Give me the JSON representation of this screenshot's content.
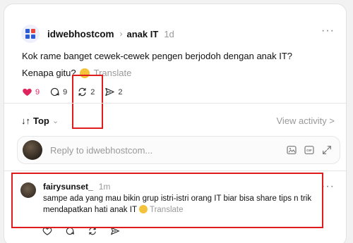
{
  "post": {
    "author": "idwebhostcom",
    "community": "anak IT",
    "time": "1d",
    "more": "···",
    "text_line1": "Kok rame banget cewek-cewek pengen berjodoh dengan anak IT?",
    "text_line2": "Kenapa gitu?",
    "translate": "Translate",
    "likes": "9",
    "comments": "9",
    "reposts": "2",
    "shares": "2"
  },
  "thread": {
    "sort_label": "Top",
    "view_activity": "View activity >"
  },
  "reply": {
    "placeholder": "Reply to idwebhostcom..."
  },
  "comment": {
    "author": "fairysunset_",
    "time": "1m",
    "more": "···",
    "text_before_emoji": "sampe ada yang mau bikin grup istri-istri orang IT biar bisa share tips n trik mendapatkan hati anak IT",
    "translate": "Translate"
  },
  "colors": {
    "accent_like": "#e0245e",
    "highlight": "#e01b1b",
    "muted": "#999999"
  },
  "icons": [
    "logo-icon",
    "chevron-right-icon",
    "more-icon",
    "heart-icon",
    "comment-icon",
    "repost-icon",
    "share-icon",
    "chevron-down-icon",
    "image-icon",
    "gif-icon",
    "expand-icon"
  ]
}
